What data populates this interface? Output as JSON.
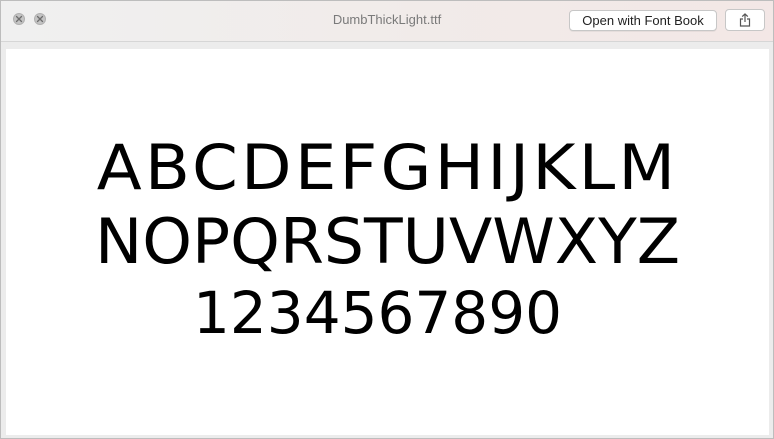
{
  "window": {
    "title": "DumbThickLight.ttf",
    "open_button_label": "Open with Font Book",
    "share_icon": "share-icon",
    "close_icon": "close-icon",
    "minimize_icon": "minimize-icon"
  },
  "preview": {
    "line1": "ABCDEFGHIJKLM",
    "line2": "NOPQRSTUVWXYZ",
    "line3": "1234567890"
  },
  "colors": {
    "titlebar": "#f0f0f0",
    "content_bg": "#ffffff",
    "glyph": "#000000",
    "title_text": "#7a7a7a"
  }
}
